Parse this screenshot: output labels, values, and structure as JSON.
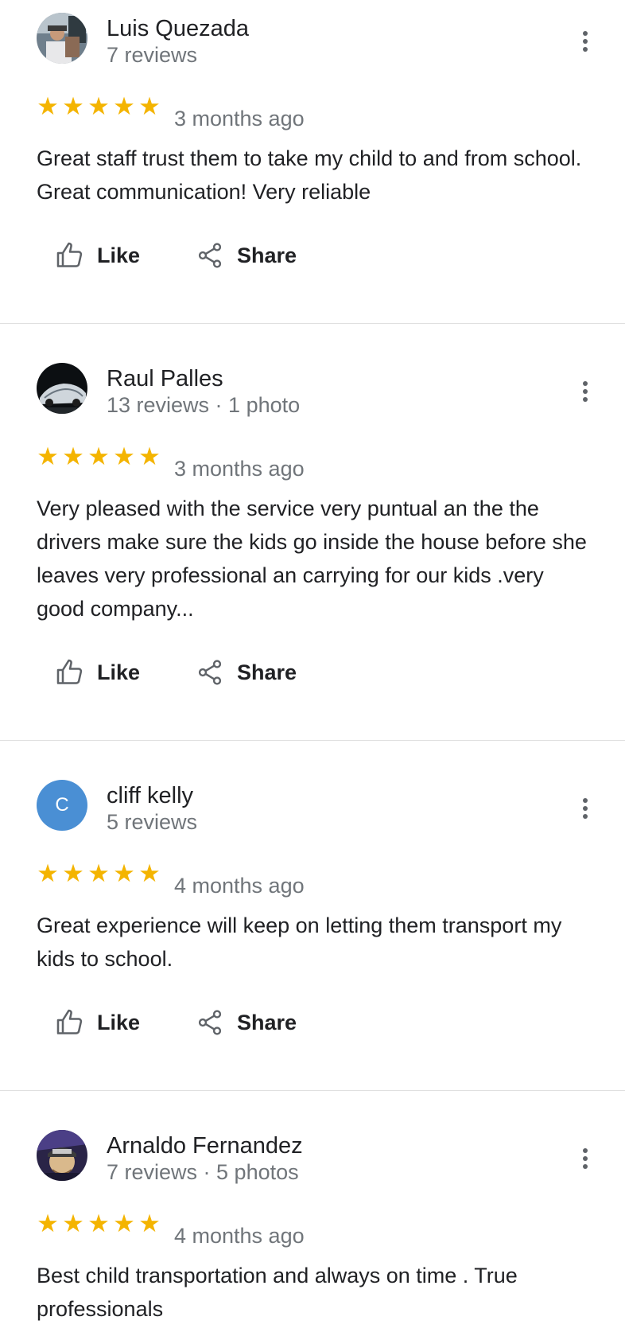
{
  "actions": {
    "like_label": "Like",
    "share_label": "Share"
  },
  "colors": {
    "star": "#f4b400",
    "muted_text": "#70757a",
    "primary_text": "#202124",
    "divider": "#e0e0e0",
    "letter_avatar_bg": "#4a8fd4"
  },
  "reviews": [
    {
      "author": "Luis Quezada",
      "meta": "7 reviews",
      "rating": 5,
      "date": "3 months ago",
      "text": "Great staff trust them to take my child to and from school. Great communication! Very reliable",
      "avatar": {
        "kind": "photo"
      }
    },
    {
      "author": "Raul Palles",
      "meta": "13 reviews · 1 photo",
      "rating": 5,
      "date": "3 months ago",
      "text": "Very pleased with the service very puntual an the the drivers make sure the kids go inside the house before she leaves very professional an carrying for our kids .very good company...",
      "avatar": {
        "kind": "photo"
      }
    },
    {
      "author": "cliff kelly",
      "meta": "5 reviews",
      "rating": 5,
      "date": "4 months ago",
      "text": "Great experience will keep on letting them transport my kids to school.",
      "avatar": {
        "kind": "letter",
        "letter": "C"
      }
    },
    {
      "author": "Arnaldo Fernandez",
      "meta": "7 reviews · 5 photos",
      "rating": 5,
      "date": "4 months ago",
      "text": "Best child transportation and always on time . True professionals",
      "avatar": {
        "kind": "photo"
      }
    }
  ]
}
